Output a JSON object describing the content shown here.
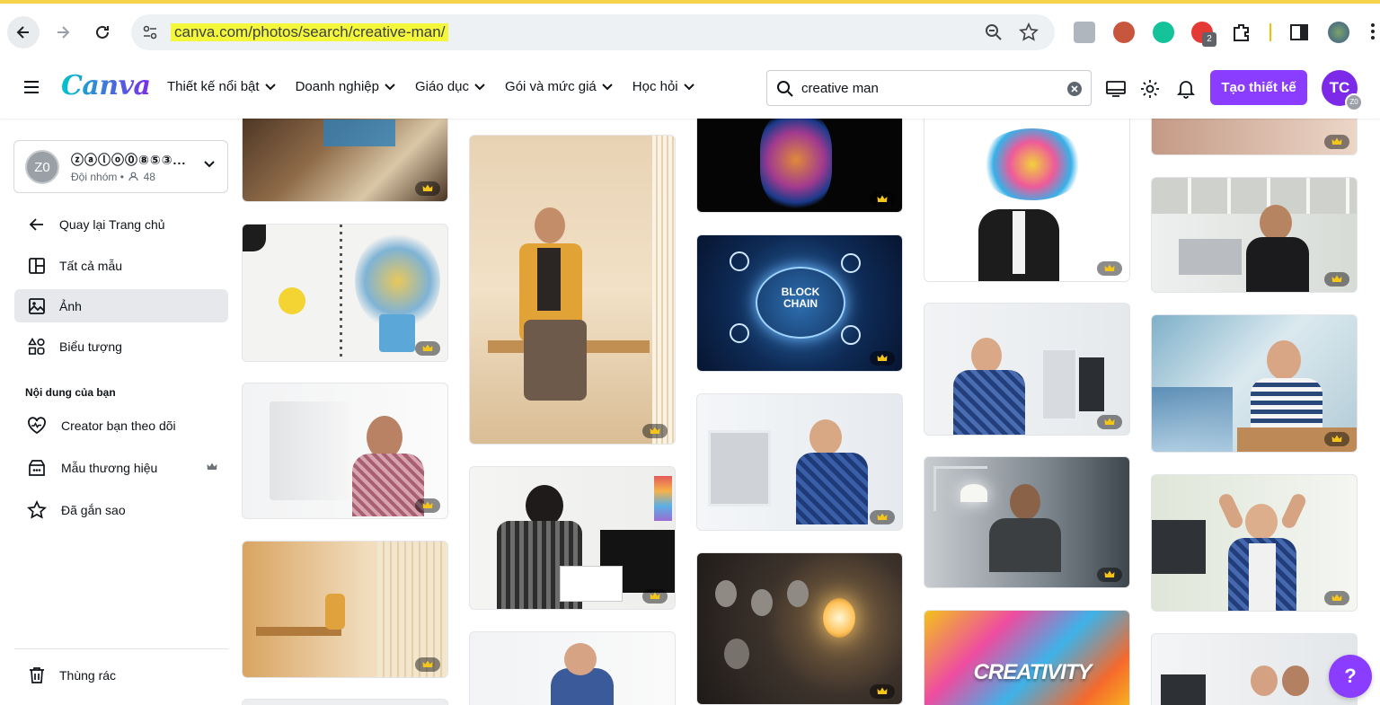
{
  "browser": {
    "url": "canva.com/photos/search/creative-man/",
    "ext_badge": "2"
  },
  "header": {
    "logo": "Canva",
    "nav": [
      {
        "label": "Thiết kế nổi bật"
      },
      {
        "label": "Doanh nghiệp"
      },
      {
        "label": "Giáo dục"
      },
      {
        "label": "Gói và mức giá"
      },
      {
        "label": "Học hỏi"
      }
    ],
    "search_value": "creative man",
    "create_label": "Tạo thiết kế",
    "avatar_initials": "TC",
    "avatar_mini": "Z0"
  },
  "sidebar": {
    "team_name": "ⓩⓐⓛⓞ⓪⑧⑤③...",
    "team_avatar": "Z0",
    "team_sub": "Đội nhóm •",
    "team_members": "48",
    "items": [
      {
        "label": "Quay lại Trang chủ"
      },
      {
        "label": "Tất cả mẫu"
      },
      {
        "label": "Ảnh"
      },
      {
        "label": "Biểu tượng"
      }
    ],
    "section_title": "Nội dung của bạn",
    "content_items": [
      {
        "label": "Creator bạn theo dõi"
      },
      {
        "label": "Mẫu thương hiệu"
      },
      {
        "label": "Đã gắn sao"
      }
    ],
    "trash_label": "Thùng rác"
  },
  "photos": {
    "blockchain_text_1": "BLOCK",
    "blockchain_text_2": "CHAIN",
    "creativity_text": "CREATIVITY"
  },
  "help_label": "?",
  "colors": {
    "brand": "#8b3dff",
    "url_highlight": "#f5f73a"
  }
}
